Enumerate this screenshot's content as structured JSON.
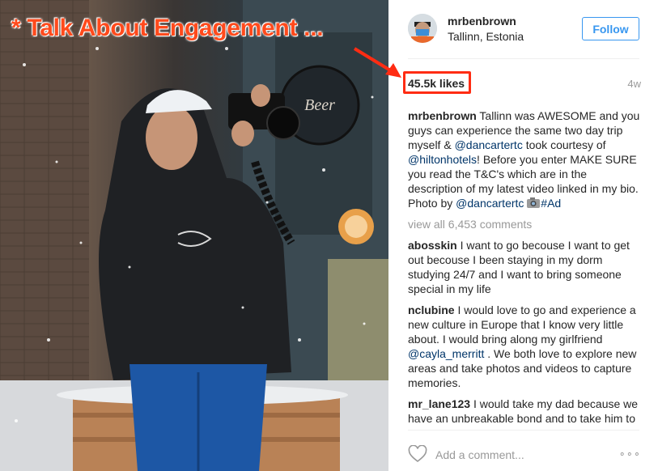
{
  "annotation": {
    "title": "* Talk About Engagement ..."
  },
  "post": {
    "username": "mrbenbrown",
    "location": "Tallinn, Estonia",
    "follow_label": "Follow",
    "likes": "45.5k likes",
    "age": "4w",
    "caption": {
      "username": "mrbenbrown",
      "part1": " Tallinn was AWESOME and you guys can experience the same two day trip myself & ",
      "mention1": "@dancartertc",
      "part2": " took courtesy of ",
      "mention2": "@hiltonhotels",
      "part3": "! Before you enter MAKE SURE you read the T&C's which are in the description of my latest video linked in my bio. Photo by ",
      "mention3": "@dancartertc",
      "hashtag": "#Ad"
    },
    "view_all": "view all 6,453 comments",
    "comments": [
      {
        "username": "abosskin",
        "text_before": " I want to go becouse I want to get out becouse I been staying in my dorm studying 24/7 and I want to bring someone special in my life",
        "mention": "",
        "text_after": ""
      },
      {
        "username": "nclubine",
        "text_before": " I would love to go and experience a new culture in Europe that I know very little about. I would bring along my girlfriend ",
        "mention": "@cayla_merritt",
        "text_after": " . We both love to explore new areas and take photos and videos to capture memories."
      },
      {
        "username": "mr_lane123",
        "text_before": " I would take my dad because we have an unbreakable bond and to take him to this amazing place would just be",
        "mention": "",
        "text_after": ""
      }
    ],
    "add_comment_placeholder": "Add a comment...",
    "more_glyph": "∘∘∘"
  },
  "icons": {
    "heart": "heart-icon",
    "more": "more-options-icon",
    "camera_emoji": "camera-emoji-icon"
  },
  "colors": {
    "accent": "#3897f0",
    "annotation": "#ff4a1c",
    "highlight_box": "#ff2c13",
    "mention": "#003569"
  }
}
